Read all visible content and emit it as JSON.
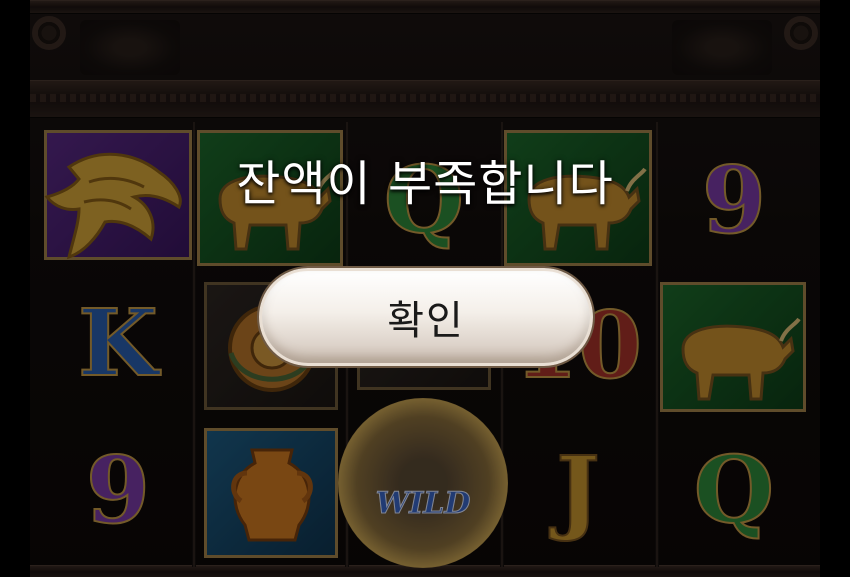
{
  "dialog": {
    "message": "잔액이 부족합니다",
    "confirm_label": "확인"
  },
  "reels": {
    "symbols": [
      {
        "id": "eagle",
        "letter": ""
      },
      {
        "id": "bull",
        "letter": ""
      },
      {
        "id": "queen-green",
        "letter": "Q"
      },
      {
        "id": "bull",
        "letter": ""
      },
      {
        "id": "nine-purple",
        "letter": "9"
      },
      {
        "id": "king-blue",
        "letter": "K"
      },
      {
        "id": "shield",
        "letter": ""
      },
      {
        "id": "ten-red",
        "letter": "10"
      },
      {
        "id": "bull",
        "letter": ""
      },
      {
        "id": "nine-purple",
        "letter": "9"
      },
      {
        "id": "vase",
        "letter": ""
      },
      {
        "id": "wild-zeus",
        "letter": "WILD"
      },
      {
        "id": "jack-gold",
        "letter": "J"
      },
      {
        "id": "queen-green",
        "letter": "Q"
      }
    ]
  },
  "colors": {
    "frame_gold": "#a4844b",
    "purple_tile": "#5a2a86",
    "green_tile": "#1d6a2c",
    "blue_tile": "#1e5d84",
    "button_face": "#f4efe9"
  }
}
